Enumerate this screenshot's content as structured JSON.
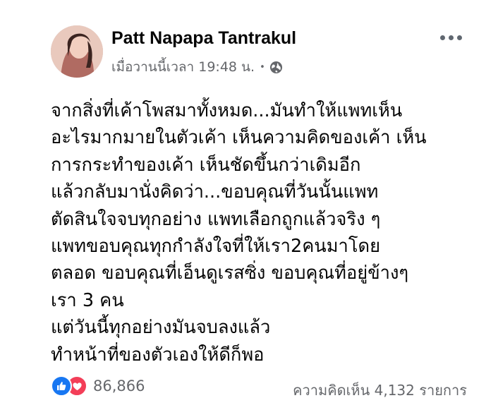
{
  "post": {
    "author": "Patt Napapa Tantrakul",
    "timestamp": "เมื่อวานนี้เวลา 19:48 น.",
    "separator": "•",
    "privacy_icon": "globe-icon",
    "more_icon": "more-options-icon",
    "body_lines": [
      "จากสิ่งที่เค้าโพสมาทั้งหมด...มันทำให้แพทเห็น",
      "อะไรมากมายในตัวเค้า เห็นความคิดของเค้า เห็น",
      "การกระทำของเค้า เห็นชัดขึ้นกว่าเดิมอีก",
      "แล้วกลับมานั่งคิดว่า...ขอบคุณที่วันนั้นแพท",
      "ตัดสินใจจบทุกอย่าง แพทเลือกถูกแล้วจริง ๆ",
      "แพทขอบคุณทุกกำลังใจที่ให้เรา2คนมาโดย",
      "ตลอด ขอบคุณที่เอ็นดูเรสซิ่ง ขอบคุณที่อยู่ข้างๆ",
      "เรา 3 คน",
      "แต่วันนี้ทุกอย่างมันจบลงแล้ว",
      "ทำหน้าที่ของตัวเองให้ดีก็พอ"
    ]
  },
  "footer": {
    "reaction_count": "86,866",
    "comment_count": "ความคิดเห็น 4,132 รายการ",
    "reaction_icons": [
      "like-icon",
      "love-icon"
    ]
  },
  "colors": {
    "like": "#1877f2",
    "love": "#f33e58",
    "secondary_text": "#65676b"
  }
}
